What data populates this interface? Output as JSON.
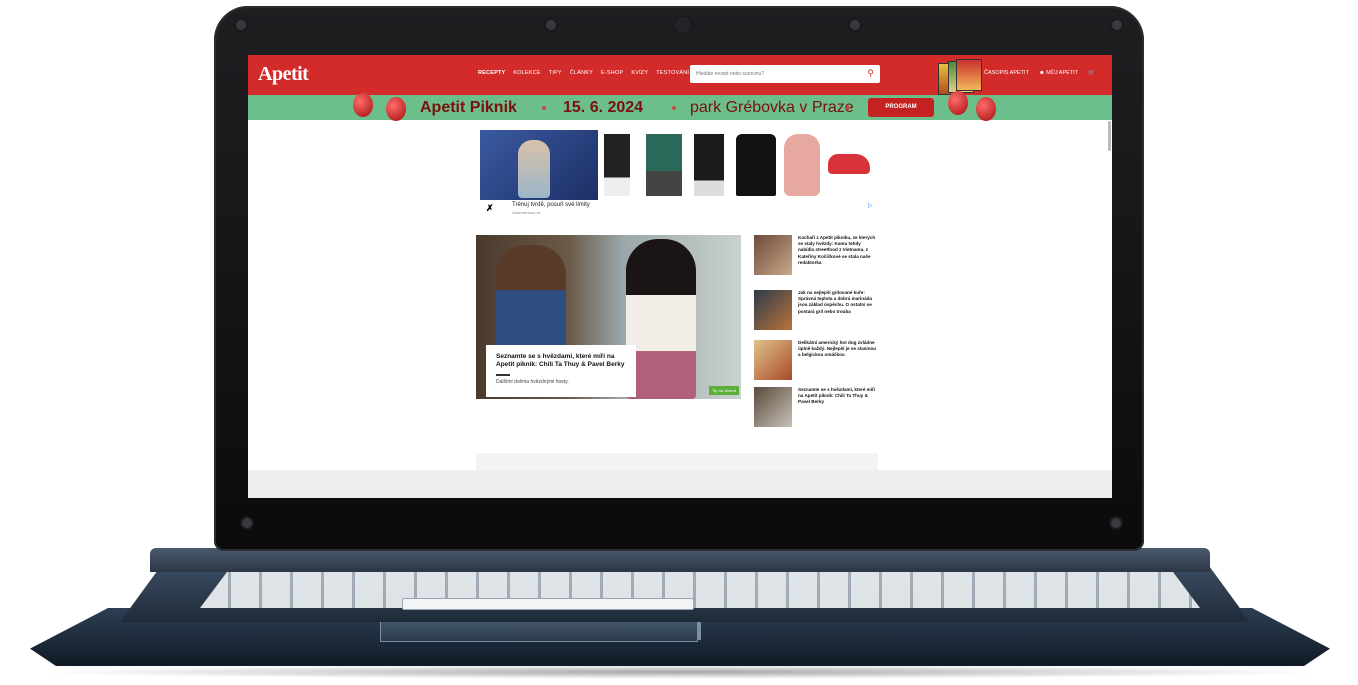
{
  "site": {
    "logo": "Apetit",
    "nav": [
      "RECEPTY",
      "KOLEKCE",
      "TIPY",
      "ČLÁNKY",
      "E-SHOP",
      "KVÍZY",
      "TESTOVÁNÍ"
    ],
    "search_placeholder": "Hledáte recept nebo surovinu?",
    "right_links": [
      "ČASOPIS APETIT",
      "MŮJ APETIT"
    ],
    "brand_color": "#d32a2a"
  },
  "banner": {
    "event": "Apetit Piknik",
    "date": "15. 6. 2024",
    "park": "park Grébovka v Praze",
    "button": "PROGRAM",
    "bg_color": "#6cbf8a"
  },
  "ad": {
    "headline": "Trénuj tvrdě, posuň své limity",
    "sub": "Underarmour.cz"
  },
  "main_article": {
    "title": "Seznamte se s hvězdami, které míří na Apetit piknik: Chili Ta Thuy & Pavel Berky",
    "subtitle": "Dalšími dvěma hvězdnými hosty.",
    "tag": "Tip na víkend"
  },
  "side_articles": [
    {
      "title": "Kuchaři z Apetit pikniku, ze kterých se staly hvězdy: Kamu tehdy nabídla streetfood z Vietnamu, z Kateřiny Kočíčkové se stala naše redaktorka"
    },
    {
      "title": "Jak na nejlepší grilované kuře: Správná teplota a dobrá marináda jsou základ úspěchu. O ostatní se postará gril nebo trouba"
    },
    {
      "title": "Delikátní americký hot dog zvládne úplně každý. Nejlepší je se slaninou a belgickou omáčkou"
    },
    {
      "title": "Seznamte se s hvězdami, které míří na Apetit piknik: Chili Ta Thuy & Pavel Berky"
    }
  ],
  "icons": {
    "search": "magnifier",
    "user": "user-outline",
    "cart": "shopping-cart"
  }
}
